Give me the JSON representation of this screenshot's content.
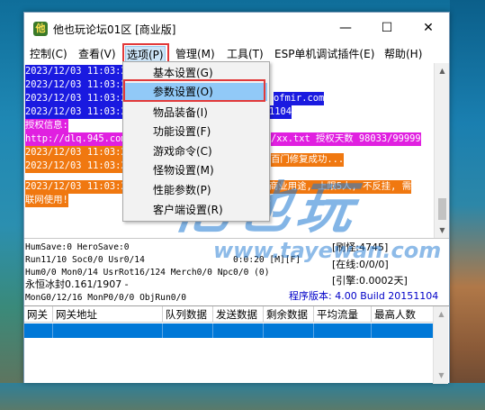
{
  "window": {
    "title": "他也玩论坛01区 [商业版]",
    "icon_glyph": "他",
    "minimize_glyph": "—",
    "maximize_glyph": "☐",
    "close_glyph": "✕"
  },
  "menu": {
    "items": [
      {
        "label": "控制(C)"
      },
      {
        "label": "查看(V)"
      },
      {
        "label": "选项(P)"
      },
      {
        "label": "管理(M)"
      },
      {
        "label": "工具(T)"
      },
      {
        "label": "ESP单机调试插件(E)"
      },
      {
        "label": "帮助(H)"
      }
    ],
    "active_index": 2
  },
  "options_dropdown": {
    "items": [
      {
        "label": "基本设置(G)"
      },
      {
        "label": "参数设置(O)"
      },
      {
        "label": "物品装备(I)"
      },
      {
        "label": "功能设置(F)"
      },
      {
        "label": "游戏命令(C)"
      },
      {
        "label": "怪物设置(M)"
      },
      {
        "label": "性能参数(P)"
      },
      {
        "label": "客户端设置(R)"
      }
    ],
    "highlighted_index": 1
  },
  "log": {
    "lines": [
      {
        "text": "2023/12/03 11:03:2",
        "bg": "#1a1ae0"
      },
      {
        "text": "2023/12/03 11:03:2",
        "bg": "#1a1ae0"
      },
      {
        "text": "2023/12/03 11:03:2",
        "bg": "#1a1ae0"
      },
      {
        "text": "2023/12/03 11:03:2",
        "bg": "#1a1ae0"
      },
      {
        "text": "授权信息:",
        "bg": "#e020e0"
      },
      {
        "text": "http://dlq.945.com",
        "bg": "#e020e0"
      },
      {
        "text": "2023/12/03 11:03:2",
        "bg": "#f07810"
      },
      {
        "text": "2023/12/03 11:03:2",
        "bg": "#f07810"
      },
      {
        "text": "2023/12/03 11:03:2",
        "bg": "#f07810"
      },
      {
        "text": "联网使用!",
        "bg": "#f07810"
      }
    ],
    "fragments": [
      {
        "text": "ofmir.com",
        "bg": "#1a1ae0"
      },
      {
        "text": "1104",
        "bg": "#1a1ae0"
      },
      {
        "text": "/xx.txt 授权天数 98033/99999",
        "bg": "#e020e0"
      },
      {
        "text": "百门修复成功...",
        "bg": "#f07810"
      },
      {
        "text": "商业用途, 上限5人, 不反挂, 需",
        "bg": "#f07810"
      }
    ]
  },
  "status": {
    "line1": "HumSave:0 HeroSave:0",
    "line2a": "Run11/10 Soc0/0 Usr0/14",
    "line2b": "0:0:20 [M][F]",
    "line3": "Hum0/0 Mon0/14 UsrRot16/124 Merch0/0 Npc0/0 (0)",
    "line4": "永恒冰封0.161/1907 -",
    "line5": "MonG0/12/16 MonP0/0/0 ObjRun0/0",
    "right1": "[刷怪:4745]",
    "right2": "[在线:0/0/0]",
    "right3": "[引擎:0.0002天]",
    "version": "程序版本: 4.00 Build 20151104"
  },
  "gateway_table": {
    "headers": [
      "网关",
      "网关地址",
      "队列数据",
      "发送数据",
      "剩余数据",
      "平均流量",
      "最高人数"
    ]
  },
  "watermark": {
    "text": "他也玩",
    "url": "www.tayewan.com"
  },
  "colors": {
    "log_blue": "#1a1ae0",
    "log_magenta": "#e020e0",
    "log_orange": "#f07810",
    "selection_blue": "#0078d7",
    "highlight_red": "#e23a3a",
    "menu_hover": "#91c9f7"
  }
}
